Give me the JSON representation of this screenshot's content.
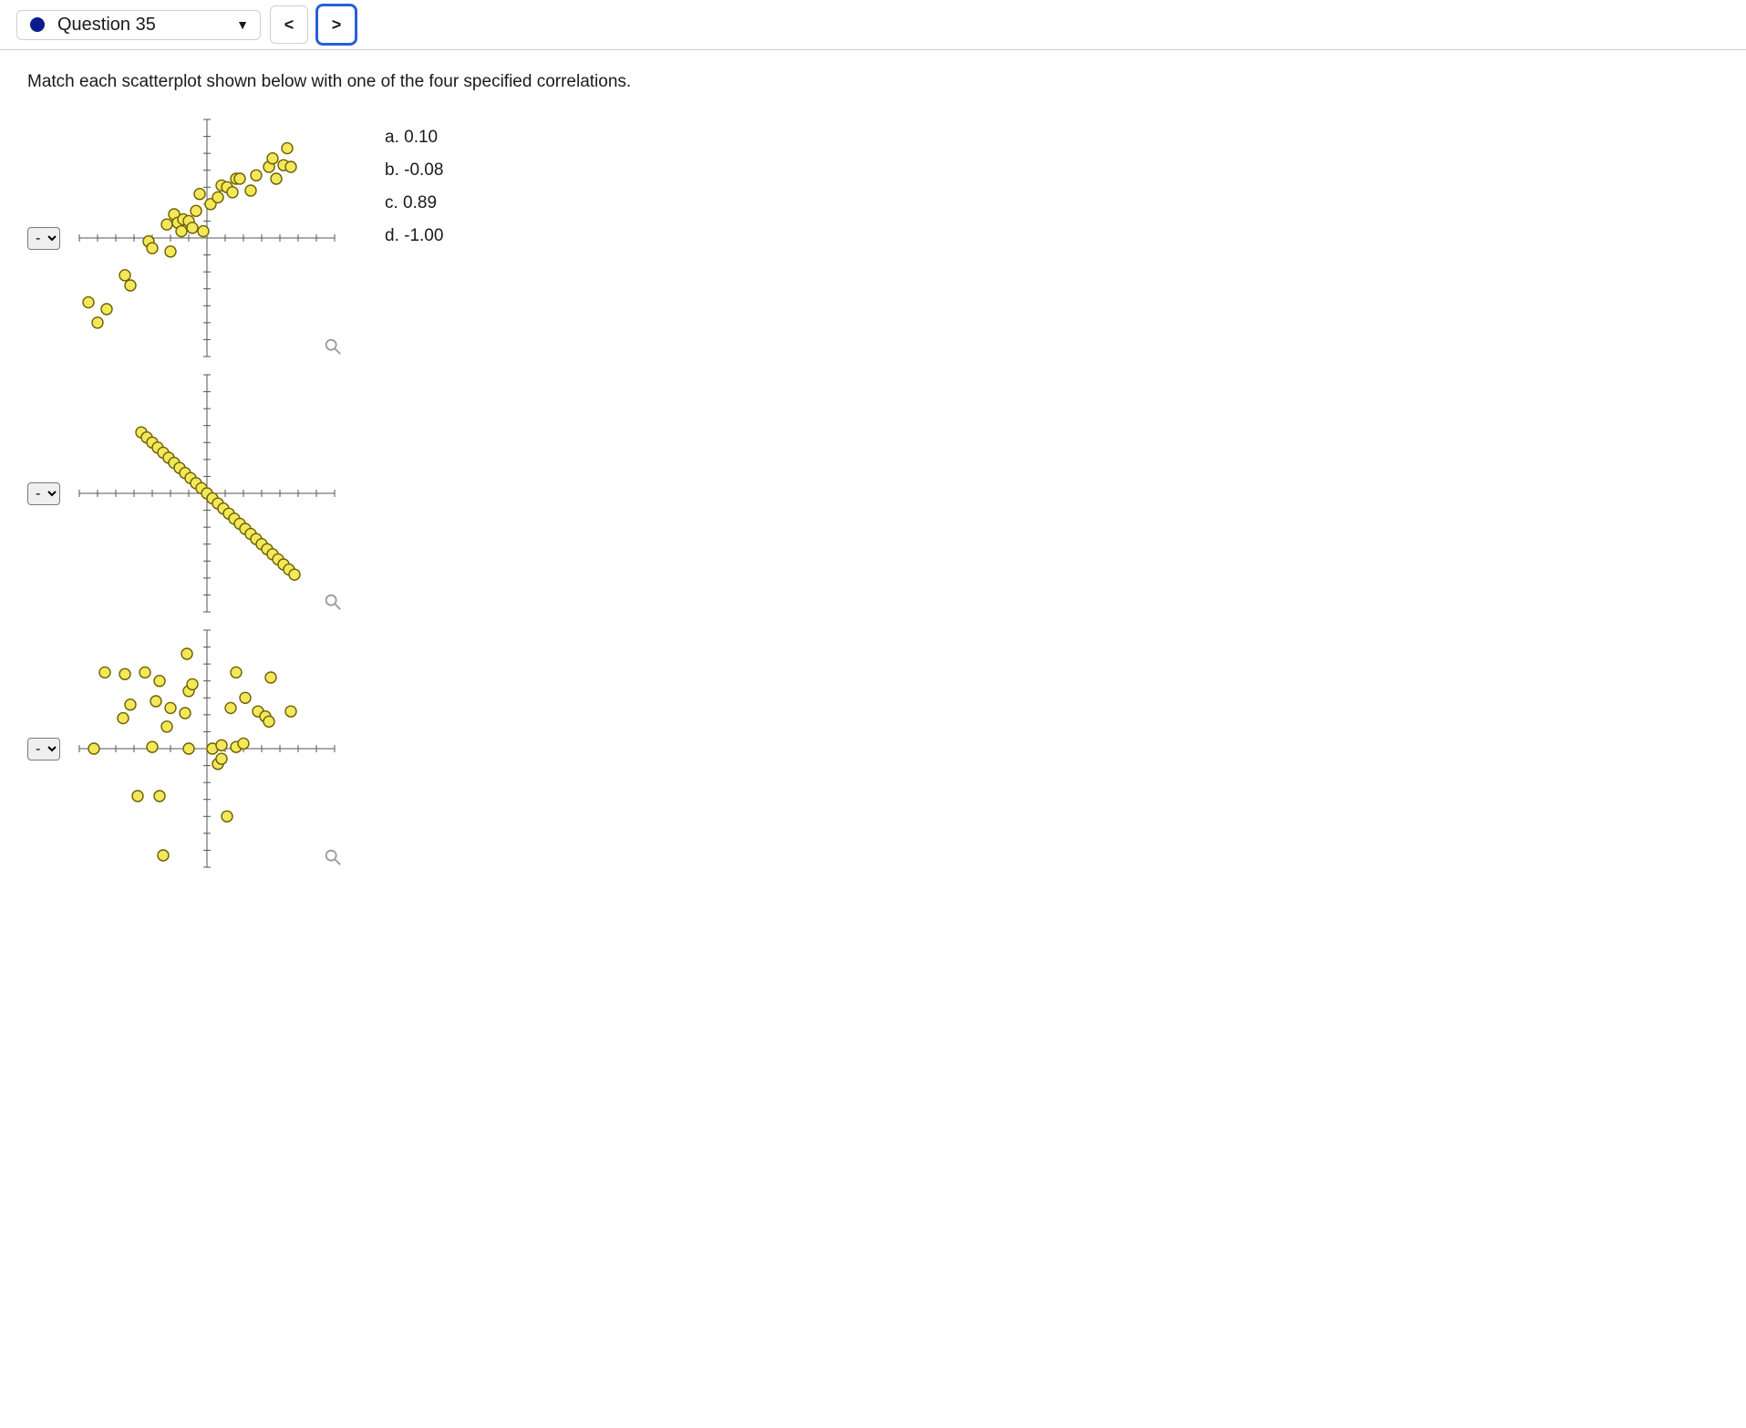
{
  "header": {
    "question_label": "Question 35",
    "prev_label": "<",
    "next_label": ">"
  },
  "prompt": "Match each scatterplot shown below with one of the four specified correlations.",
  "answer_placeholder": "-",
  "options_list": {
    "a": "a. 0.10",
    "b": "b. -0.08",
    "c": "c. 0.89",
    "d": "d. -1.00"
  },
  "chart_data": [
    {
      "type": "scatter",
      "title": "",
      "xlabel": "",
      "ylabel": "",
      "xlim": [
        -7,
        7
      ],
      "ylim": [
        -7,
        7
      ],
      "series": [
        {
          "name": "points",
          "values": [
            [
              -6.5,
              -3.8
            ],
            [
              -6,
              -5.0
            ],
            [
              -5.5,
              -4.2
            ],
            [
              -4.5,
              -2.2
            ],
            [
              -4.2,
              -2.8
            ],
            [
              -3.2,
              -0.2
            ],
            [
              -3.0,
              -0.6
            ],
            [
              -2.2,
              0.8
            ],
            [
              -2.0,
              -0.8
            ],
            [
              -1.8,
              1.4
            ],
            [
              -1.6,
              0.9
            ],
            [
              -1.4,
              0.4
            ],
            [
              -1.3,
              1.1
            ],
            [
              -1.0,
              1.0
            ],
            [
              -0.8,
              0.6
            ],
            [
              -0.6,
              1.6
            ],
            [
              -0.4,
              2.6
            ],
            [
              -0.2,
              0.4
            ],
            [
              0.2,
              2.0
            ],
            [
              0.6,
              2.4
            ],
            [
              0.8,
              3.1
            ],
            [
              1.1,
              3.0
            ],
            [
              1.4,
              2.7
            ],
            [
              1.6,
              3.5
            ],
            [
              1.8,
              3.5
            ],
            [
              2.4,
              2.8
            ],
            [
              2.7,
              3.7
            ],
            [
              3.4,
              4.2
            ],
            [
              3.6,
              4.7
            ],
            [
              3.8,
              3.5
            ],
            [
              4.2,
              4.3
            ],
            [
              4.6,
              4.2
            ],
            [
              4.4,
              5.3
            ]
          ]
        }
      ]
    },
    {
      "type": "scatter",
      "title": "",
      "xlabel": "",
      "ylabel": "",
      "xlim": [
        -7,
        7
      ],
      "ylim": [
        -7,
        7
      ],
      "series": [
        {
          "name": "points",
          "values": [
            [
              -3.6,
              3.6
            ],
            [
              -3.3,
              3.3
            ],
            [
              -3.0,
              3.0
            ],
            [
              -2.7,
              2.7
            ],
            [
              -2.4,
              2.4
            ],
            [
              -2.1,
              2.1
            ],
            [
              -1.8,
              1.8
            ],
            [
              -1.5,
              1.5
            ],
            [
              -1.2,
              1.2
            ],
            [
              -0.9,
              0.9
            ],
            [
              -0.6,
              0.6
            ],
            [
              -0.3,
              0.3
            ],
            [
              0.0,
              0.0
            ],
            [
              0.3,
              -0.3
            ],
            [
              0.6,
              -0.6
            ],
            [
              0.9,
              -0.9
            ],
            [
              1.2,
              -1.2
            ],
            [
              1.5,
              -1.5
            ],
            [
              1.8,
              -1.8
            ],
            [
              2.1,
              -2.1
            ],
            [
              2.4,
              -2.4
            ],
            [
              2.7,
              -2.7
            ],
            [
              3.0,
              -3.0
            ],
            [
              3.3,
              -3.3
            ],
            [
              3.6,
              -3.6
            ],
            [
              3.9,
              -3.9
            ],
            [
              4.2,
              -4.2
            ],
            [
              4.5,
              -4.5
            ],
            [
              4.8,
              -4.8
            ]
          ]
        }
      ]
    },
    {
      "type": "scatter",
      "title": "",
      "xlabel": "",
      "ylabel": "",
      "xlim": [
        -7,
        7
      ],
      "ylim": [
        -7,
        7
      ],
      "series": [
        {
          "name": "points",
          "values": [
            [
              -6.2,
              0.0
            ],
            [
              -5.6,
              4.5
            ],
            [
              -4.6,
              1.8
            ],
            [
              -4.5,
              4.4
            ],
            [
              -4.2,
              2.6
            ],
            [
              -3.8,
              -2.8
            ],
            [
              -3.4,
              4.5
            ],
            [
              -3.0,
              0.1
            ],
            [
              -2.8,
              2.8
            ],
            [
              -2.6,
              4.0
            ],
            [
              -2.6,
              -2.8
            ],
            [
              -2.2,
              1.3
            ],
            [
              -2.0,
              2.4
            ],
            [
              -1.2,
              2.1
            ],
            [
              -1.1,
              5.6
            ],
            [
              -1.0,
              0.0
            ],
            [
              -1.0,
              3.4
            ],
            [
              -0.8,
              3.8
            ],
            [
              0.3,
              0.0
            ],
            [
              0.6,
              -0.9
            ],
            [
              0.8,
              0.2
            ],
            [
              0.8,
              -0.6
            ],
            [
              1.1,
              -4.0
            ],
            [
              1.3,
              2.4
            ],
            [
              1.6,
              0.1
            ],
            [
              1.6,
              4.5
            ],
            [
              2.0,
              0.3
            ],
            [
              2.1,
              3.0
            ],
            [
              2.8,
              2.2
            ],
            [
              3.2,
              1.9
            ],
            [
              3.4,
              1.6
            ],
            [
              3.5,
              4.2
            ],
            [
              4.6,
              2.2
            ],
            [
              -2.4,
              -6.3
            ]
          ]
        }
      ]
    }
  ]
}
